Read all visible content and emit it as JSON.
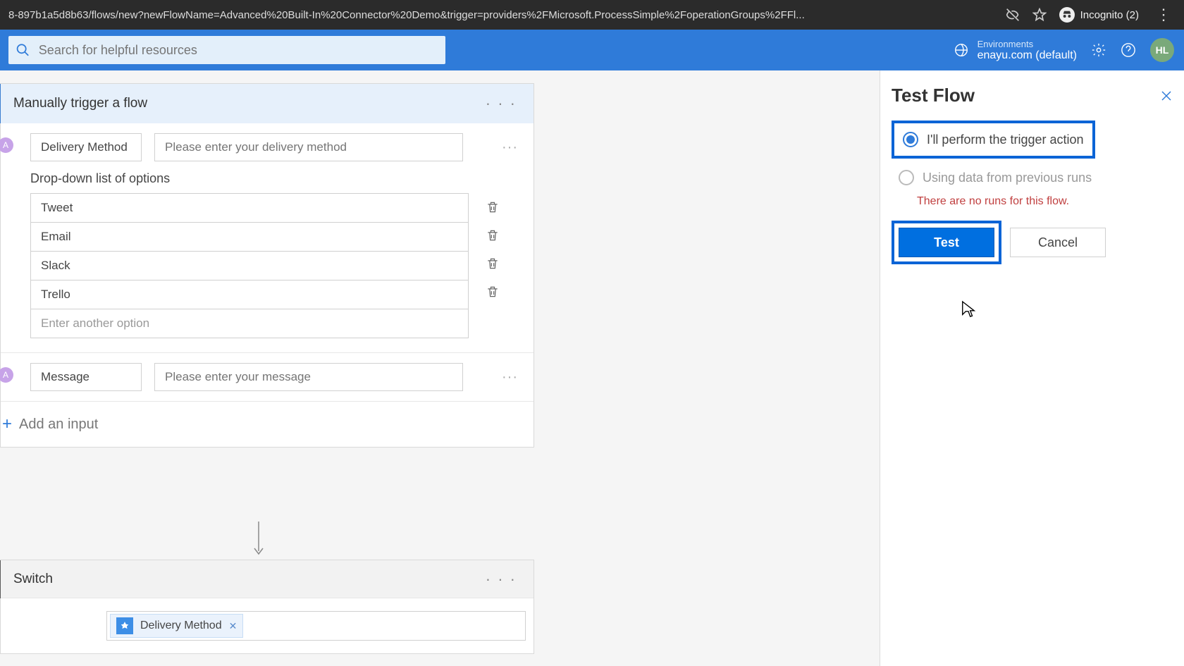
{
  "browser": {
    "url": "8-897b1a5d8b63/flows/new?newFlowName=Advanced%20Built-In%20Connector%20Demo&trigger=providers%2FMicrosoft.ProcessSimple%2FoperationGroups%2FFl...",
    "incognito": "Incognito (2)"
  },
  "header": {
    "search_placeholder": "Search for helpful resources",
    "env_label": "Environments",
    "env_value": "enayu.com (default)",
    "avatar": "HL"
  },
  "trigger": {
    "title": "Manually trigger a flow",
    "param1_label": "Delivery Method",
    "param1_placeholder": "Please enter your delivery method",
    "dropdown_label": "Drop-down list of options",
    "options": [
      "Tweet",
      "Email",
      "Slack",
      "Trello"
    ],
    "option_placeholder": "Enter another option",
    "param2_label": "Message",
    "param2_placeholder": "Please enter your message",
    "add_input": "Add an input"
  },
  "switch": {
    "title": "Switch",
    "token": "Delivery Method"
  },
  "panel": {
    "title": "Test Flow",
    "opt1": "I'll perform the trigger action",
    "opt2": "Using data from previous runs",
    "no_runs": "There are no runs for this flow.",
    "test": "Test",
    "cancel": "Cancel"
  }
}
